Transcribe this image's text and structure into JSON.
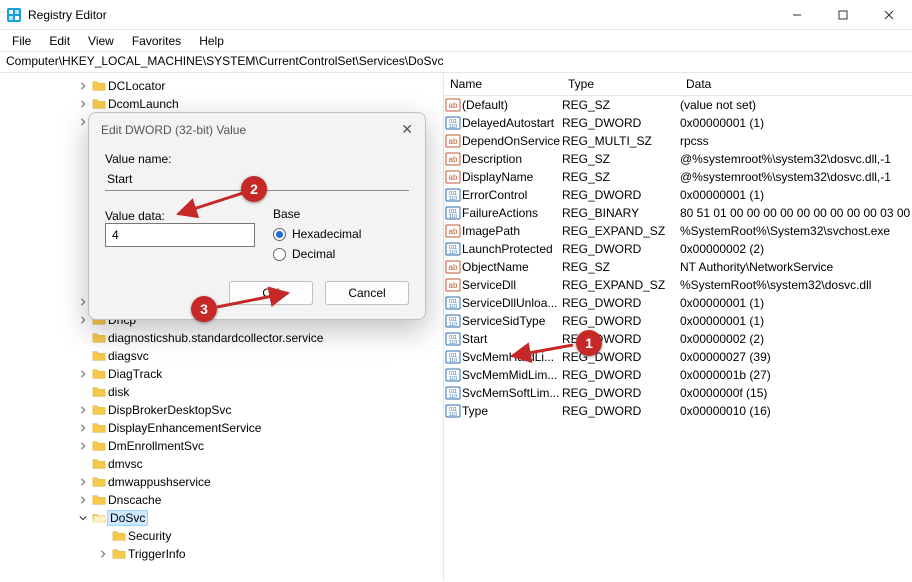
{
  "window": {
    "title": "Registry Editor"
  },
  "menu": {
    "file": "File",
    "edit": "Edit",
    "view": "View",
    "favorites": "Favorites",
    "help": "Help"
  },
  "address": "Computer\\HKEY_LOCAL_MACHINE\\SYSTEM\\CurrentControlSet\\Services\\DoSvc",
  "columns": {
    "name": "Name",
    "type": "Type",
    "data": "Data"
  },
  "tree": [
    {
      "level": "a",
      "expand": ">",
      "label": "DCLocator"
    },
    {
      "level": "a",
      "expand": ">",
      "label": "DcomLaunch"
    },
    {
      "level": "a",
      "expand": ">",
      "label": ""
    },
    {
      "level": "a",
      "expand": "",
      "label": ""
    },
    {
      "level": "a",
      "expand": "",
      "label": ""
    },
    {
      "level": "a",
      "expand": "",
      "label": ""
    },
    {
      "level": "a",
      "expand": "",
      "label": ""
    },
    {
      "level": "a",
      "expand": "",
      "label": ""
    },
    {
      "level": "a",
      "expand": "",
      "label": ""
    },
    {
      "level": "a",
      "expand": "",
      "label": ""
    },
    {
      "level": "a",
      "expand": "",
      "label": ""
    },
    {
      "level": "a",
      "expand": "",
      "label": ""
    },
    {
      "level": "a",
      "expand": ">",
      "label": "Dfsc"
    },
    {
      "level": "a",
      "expand": ">",
      "label": "Dhcp"
    },
    {
      "level": "a",
      "expand": "",
      "label": "diagnosticshub.standardcollector.service"
    },
    {
      "level": "a",
      "expand": "",
      "label": "diagsvc"
    },
    {
      "level": "a",
      "expand": ">",
      "label": "DiagTrack"
    },
    {
      "level": "a",
      "expand": "",
      "label": "disk"
    },
    {
      "level": "a",
      "expand": ">",
      "label": "DispBrokerDesktopSvc"
    },
    {
      "level": "a",
      "expand": ">",
      "label": "DisplayEnhancementService"
    },
    {
      "level": "a",
      "expand": ">",
      "label": "DmEnrollmentSvc"
    },
    {
      "level": "a",
      "expand": "",
      "label": "dmvsc"
    },
    {
      "level": "a",
      "expand": ">",
      "label": "dmwappushservice"
    },
    {
      "level": "a",
      "expand": ">",
      "label": "Dnscache"
    },
    {
      "level": "a",
      "expand": "v",
      "label": "DoSvc",
      "selected": true,
      "open": true
    },
    {
      "level": "b",
      "expand": "",
      "label": "Security"
    },
    {
      "level": "b",
      "expand": ">",
      "label": "TriggerInfo"
    }
  ],
  "values": [
    {
      "icon": "sz",
      "name": "(Default)",
      "type": "REG_SZ",
      "data": "(value not set)"
    },
    {
      "icon": "bin",
      "name": "DelayedAutostart",
      "type": "REG_DWORD",
      "data": "0x00000001 (1)"
    },
    {
      "icon": "sz",
      "name": "DependOnService",
      "type": "REG_MULTI_SZ",
      "data": "rpcss"
    },
    {
      "icon": "sz",
      "name": "Description",
      "type": "REG_SZ",
      "data": "@%systemroot%\\system32\\dosvc.dll,-1"
    },
    {
      "icon": "sz",
      "name": "DisplayName",
      "type": "REG_SZ",
      "data": "@%systemroot%\\system32\\dosvc.dll,-1"
    },
    {
      "icon": "bin",
      "name": "ErrorControl",
      "type": "REG_DWORD",
      "data": "0x00000001 (1)"
    },
    {
      "icon": "bin",
      "name": "FailureActions",
      "type": "REG_BINARY",
      "data": "80 51 01 00 00 00 00 00 00 00 00 00 03 00"
    },
    {
      "icon": "sz",
      "name": "ImagePath",
      "type": "REG_EXPAND_SZ",
      "data": "%SystemRoot%\\System32\\svchost.exe"
    },
    {
      "icon": "bin",
      "name": "LaunchProtected",
      "type": "REG_DWORD",
      "data": "0x00000002 (2)"
    },
    {
      "icon": "sz",
      "name": "ObjectName",
      "type": "REG_SZ",
      "data": "NT Authority\\NetworkService"
    },
    {
      "icon": "sz",
      "name": "ServiceDll",
      "type": "REG_EXPAND_SZ",
      "data": "%SystemRoot%\\system32\\dosvc.dll"
    },
    {
      "icon": "bin",
      "name": "ServiceDllUnloa...",
      "type": "REG_DWORD",
      "data": "0x00000001 (1)"
    },
    {
      "icon": "bin",
      "name": "ServiceSidType",
      "type": "REG_DWORD",
      "data": "0x00000001 (1)"
    },
    {
      "icon": "bin",
      "name": "Start",
      "type": "REG_DWORD",
      "data": "0x00000002 (2)"
    },
    {
      "icon": "bin",
      "name": "SvcMemHardLi...",
      "type": "REG_DWORD",
      "data": "0x00000027 (39)"
    },
    {
      "icon": "bin",
      "name": "SvcMemMidLim...",
      "type": "REG_DWORD",
      "data": "0x0000001b (27)"
    },
    {
      "icon": "bin",
      "name": "SvcMemSoftLim...",
      "type": "REG_DWORD",
      "data": "0x0000000f (15)"
    },
    {
      "icon": "bin",
      "name": "Type",
      "type": "REG_DWORD",
      "data": "0x00000010 (16)"
    }
  ],
  "dialog": {
    "title": "Edit DWORD (32-bit) Value",
    "value_name_label": "Value name:",
    "value_name": "Start",
    "value_data_label": "Value data:",
    "value_data": "4",
    "base_label": "Base",
    "hex_label": "Hexadecimal",
    "dec_label": "Decimal",
    "ok": "OK",
    "cancel": "Cancel"
  },
  "annotations": {
    "1": "1",
    "2": "2",
    "3": "3"
  }
}
